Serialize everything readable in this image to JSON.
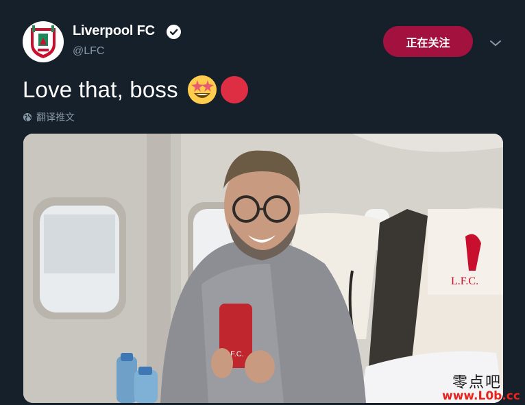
{
  "account": {
    "display_name": "Liverpool FC",
    "handle": "@LFC",
    "verified_icon": "verified-badge-icon",
    "avatar_icon": "lfc-crest-icon"
  },
  "follow_button": {
    "label": "正在关注"
  },
  "menu": {
    "icon": "chevron-down-icon"
  },
  "tweet": {
    "text": "Love that, boss",
    "emojis": [
      "star-struck-emoji",
      "red-circle-emoji"
    ]
  },
  "translate": {
    "label": "翻译推文",
    "icon": "globe-icon"
  },
  "photo": {
    "description_icon": "tweet-photo"
  },
  "watermark": {
    "line1": "零点吧",
    "line2": "www.L0b.cc"
  },
  "colors": {
    "background": "#15202b",
    "secondary_text": "#8899a6",
    "follow_button": "#a3123e",
    "lfc_red": "#c8102e"
  }
}
